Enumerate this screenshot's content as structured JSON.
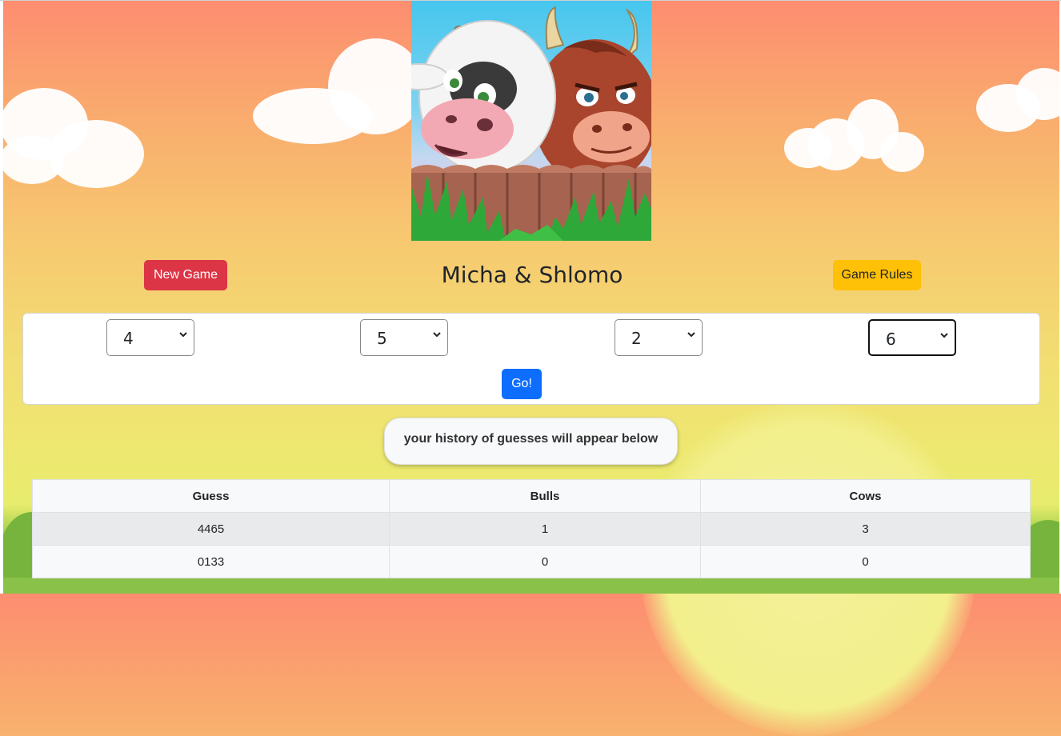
{
  "header": {
    "logo_alt": "Cow and bull cartoon",
    "title": "Micha & Shlomo",
    "new_game_label": "New Game",
    "rules_label": "Game Rules"
  },
  "guess_form": {
    "digits": [
      "4",
      "5",
      "2",
      "6"
    ],
    "go_label": "Go!"
  },
  "history": {
    "banner": "your history of guesses will appear below",
    "columns": [
      "Guess",
      "Bulls",
      "Cows"
    ],
    "rows": [
      {
        "guess": "4465",
        "bulls": "1",
        "cows": "3"
      },
      {
        "guess": "0133",
        "bulls": "0",
        "cows": "0"
      }
    ]
  },
  "colors": {
    "new_game": "#dc3545",
    "rules": "#ffc107",
    "go": "#0d6efd"
  }
}
